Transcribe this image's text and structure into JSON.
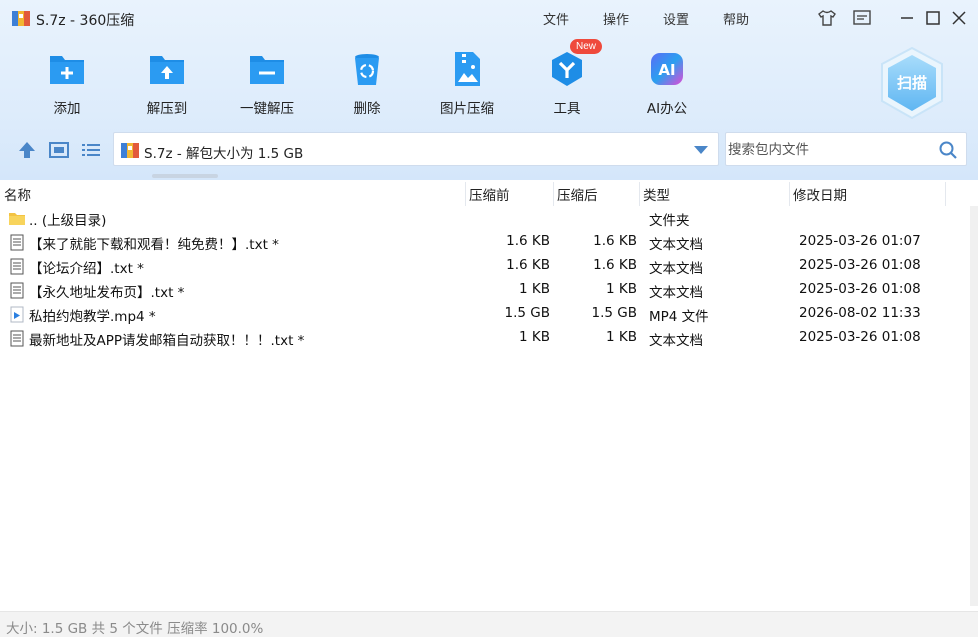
{
  "window": {
    "title": "S.7z - 360压缩",
    "menu": [
      "文件",
      "操作",
      "设置",
      "帮助"
    ]
  },
  "toolbar": {
    "items": [
      {
        "label": "添加",
        "icon": "add-folder-icon"
      },
      {
        "label": "解压到",
        "icon": "extract-folder-icon"
      },
      {
        "label": "一键解压",
        "icon": "one-click-extract-icon"
      },
      {
        "label": "删除",
        "icon": "recycle-bin-icon"
      },
      {
        "label": "图片压缩",
        "icon": "image-compress-icon"
      },
      {
        "label": "工具",
        "icon": "tools-icon",
        "badge": "New"
      },
      {
        "label": "AI办公",
        "icon": "ai-office-icon"
      }
    ],
    "scan_label": "扫描"
  },
  "address": {
    "path": "S.7z - 解包大小为 1.5 GB"
  },
  "search": {
    "placeholder": "搜索包内文件"
  },
  "columns": {
    "name": "名称",
    "before": "压缩前",
    "after": "压缩后",
    "type": "类型",
    "date": "修改日期"
  },
  "rows": [
    {
      "name": ".. (上级目录)",
      "before": "",
      "after": "",
      "type": "文件夹",
      "date": "",
      "icon": "folder-icon"
    },
    {
      "name": "【来了就能下载和观看！纯免费！】.txt *",
      "before": "1.6 KB",
      "after": "1.6 KB",
      "type": "文本文档",
      "date": "2025-03-26 01:07",
      "icon": "text-file-icon"
    },
    {
      "name": "【论坛介绍】.txt *",
      "before": "1.6 KB",
      "after": "1.6 KB",
      "type": "文本文档",
      "date": "2025-03-26 01:08",
      "icon": "text-file-icon"
    },
    {
      "name": "【永久地址发布页】.txt *",
      "before": "1 KB",
      "after": "1 KB",
      "type": "文本文档",
      "date": "2025-03-26 01:08",
      "icon": "text-file-icon"
    },
    {
      "name": "私拍约炮教学.mp4 *",
      "before": "1.5 GB",
      "after": "1.5 GB",
      "type": "MP4 文件",
      "date": "2026-08-02 11:33",
      "icon": "video-file-icon"
    },
    {
      "name": "最新地址及APP请发邮箱自动获取！！！.txt *",
      "before": "1 KB",
      "after": "1 KB",
      "type": "文本文档",
      "date": "2025-03-26 01:08",
      "icon": "text-file-icon"
    }
  ],
  "status": {
    "text": "大小: 1.5 GB 共 5 个文件 压缩率 100.0%"
  },
  "colors": {
    "accent": "#1e8de6",
    "toolbar_bg": "#dcebfb"
  }
}
